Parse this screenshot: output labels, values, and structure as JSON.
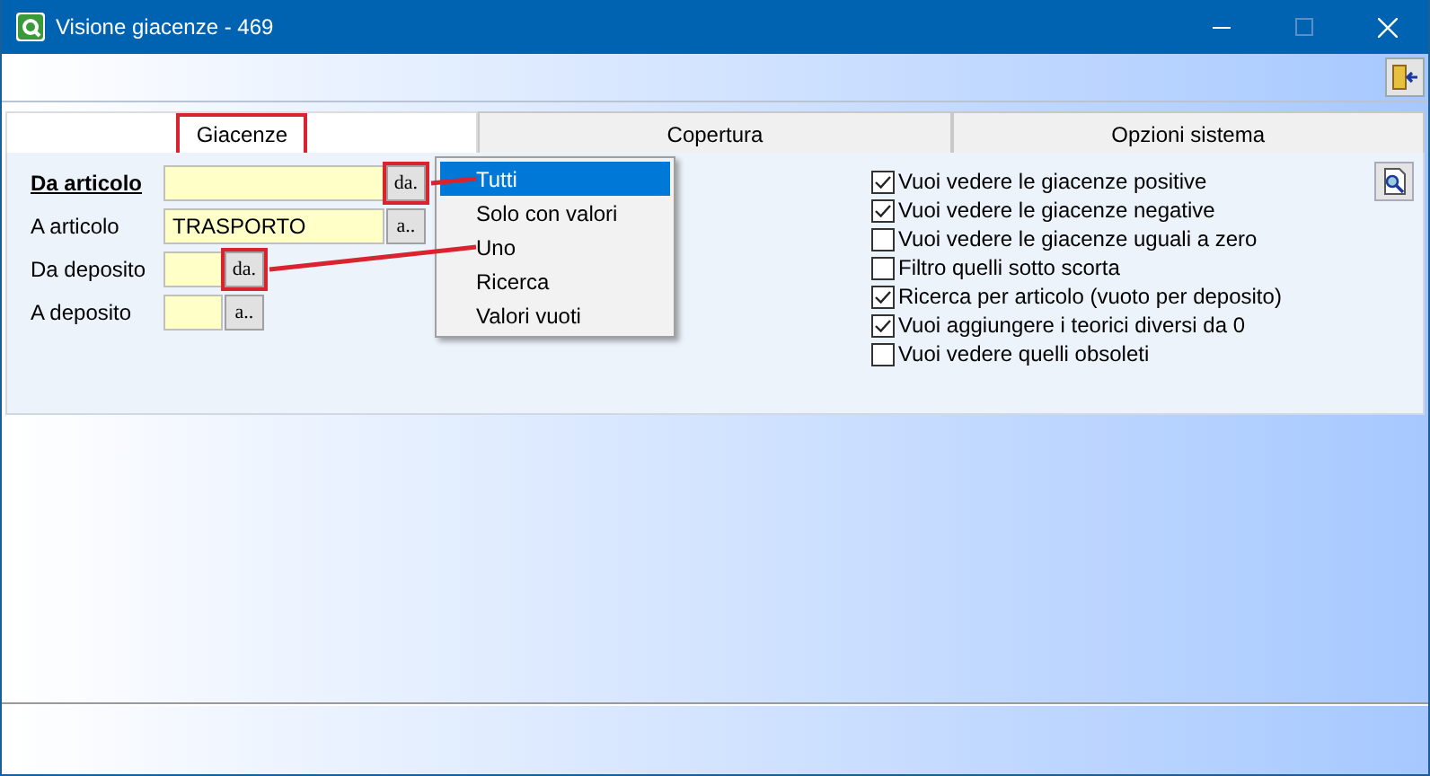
{
  "window": {
    "title": "Visione giacenze - 469"
  },
  "tabs": [
    {
      "label": "Giacenze",
      "selected": true,
      "highlighted": true
    },
    {
      "label": "Copertura",
      "selected": false,
      "highlighted": false
    },
    {
      "label": "Opzioni sistema",
      "selected": false,
      "highlighted": false
    }
  ],
  "form": {
    "rows": [
      {
        "label": "Da articolo",
        "emphasized": true,
        "value": "",
        "kind": "wide",
        "button": "da.",
        "highlighted": true
      },
      {
        "label": "A articolo",
        "emphasized": false,
        "value": "TRASPORTO",
        "kind": "wide",
        "button": "a..",
        "highlighted": false
      },
      {
        "label": "Da deposito",
        "emphasized": false,
        "value": "",
        "kind": "narrow",
        "button": "da.",
        "highlighted": true
      },
      {
        "label": "A deposito",
        "emphasized": false,
        "value": "",
        "kind": "narrow",
        "button": "a..",
        "highlighted": false
      }
    ]
  },
  "menu": {
    "items": [
      {
        "label": "Tutti",
        "selected": true,
        "linked": true
      },
      {
        "label": "Solo con valori",
        "selected": false,
        "linked": false
      },
      {
        "label": "Uno",
        "selected": false,
        "linked": true
      },
      {
        "label": "Ricerca",
        "selected": false,
        "linked": false
      },
      {
        "label": "Valori vuoti",
        "selected": false,
        "linked": false
      }
    ]
  },
  "options": [
    {
      "label": "Vuoi vedere le giacenze positive",
      "checked": true
    },
    {
      "label": "Vuoi vedere le giacenze negative",
      "checked": true
    },
    {
      "label": "Vuoi vedere le giacenze uguali a zero",
      "checked": false
    },
    {
      "label": "Filtro quelli sotto scorta",
      "checked": false
    },
    {
      "label": "Ricerca per articolo (vuoto per deposito)",
      "checked": true
    },
    {
      "label": "Vuoi aggiungere i teorici diversi da 0",
      "checked": true
    },
    {
      "label": "Vuoi vedere quelli obsoleti",
      "checked": false
    }
  ]
}
